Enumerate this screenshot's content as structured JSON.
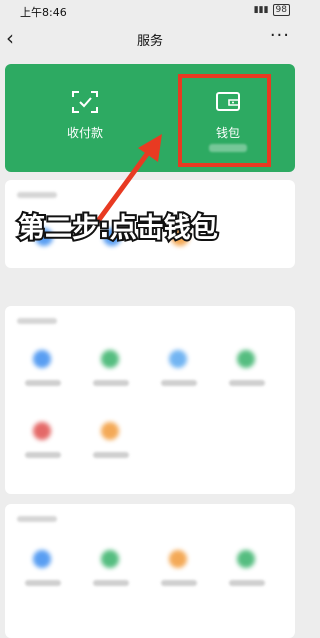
{
  "status_bar": {
    "time": "上午8:46",
    "battery": "98"
  },
  "nav": {
    "title": "服务",
    "back_icon": "chevron-left-icon",
    "more_icon": "more-dots-icon"
  },
  "top_actions": [
    {
      "label": "收付款",
      "icon": "scan-frame-icon"
    },
    {
      "label": "钱包",
      "icon": "wallet-icon"
    }
  ],
  "annotation": {
    "text": "第二步:点击钱包"
  },
  "colors": {
    "green": "#2daa62",
    "highlight": "#e83a22",
    "background": "#ededed"
  }
}
